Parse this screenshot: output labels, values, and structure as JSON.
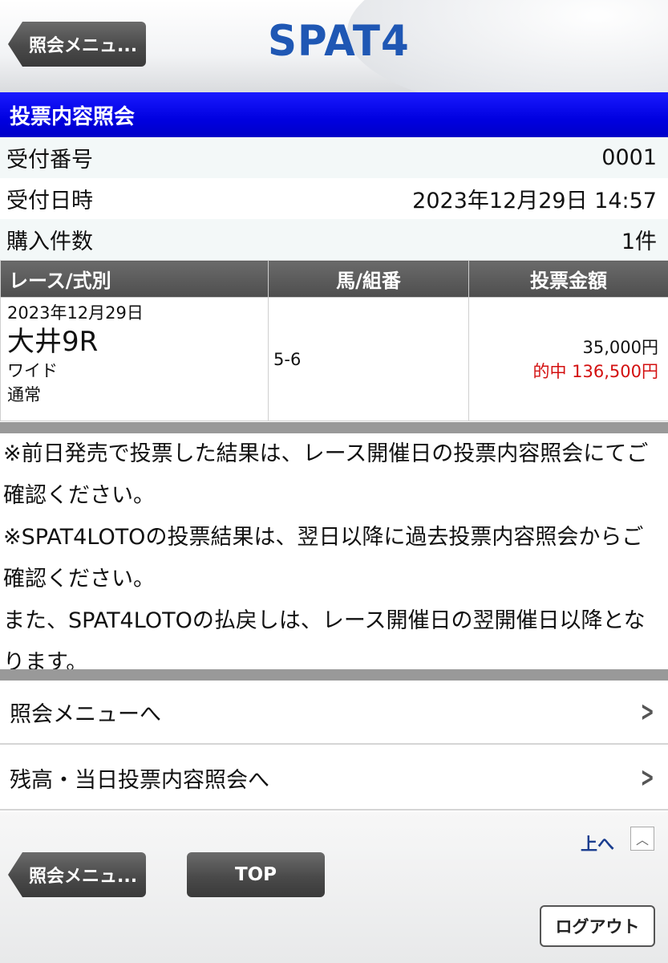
{
  "header": {
    "back_label": "照会メニュ...",
    "logo": "SPAT4"
  },
  "title": "投票内容照会",
  "info": [
    {
      "label": "受付番号",
      "value": "0001"
    },
    {
      "label": "受付日時",
      "value": "2023年12月29日 14:57"
    },
    {
      "label": "購入件数",
      "value": "1件"
    }
  ],
  "table": {
    "headers": [
      "レース/式別",
      "馬/組番",
      "投票金額"
    ],
    "row": {
      "date": "2023年12月29日",
      "race": "大井9R",
      "bet_type": "ワイド",
      "method": "通常",
      "combination": "5-6",
      "amount": "35,000円",
      "hit": "的中 136,500円"
    }
  },
  "notes": [
    "※前日発売で投票した結果は、レース開催日の投票内容照会にてご確認ください。",
    "※SPAT4LOTOの投票結果は、翌日以降に過去投票内容照会からご確認ください。",
    "また、SPAT4LOTOの払戻しは、レース開催日の翌開催日以降となります。"
  ],
  "links": [
    {
      "label": "照会メニューへ"
    },
    {
      "label": "残高・当日投票内容照会へ"
    }
  ],
  "footer": {
    "up_label": "上へ",
    "back_label": "照会メニュ...",
    "top_label": "TOP",
    "logout_label": "ログアウト"
  },
  "colors": {
    "title_bar": "#0000e0",
    "hit_text": "#d31010",
    "logo": "#1f57b4"
  }
}
